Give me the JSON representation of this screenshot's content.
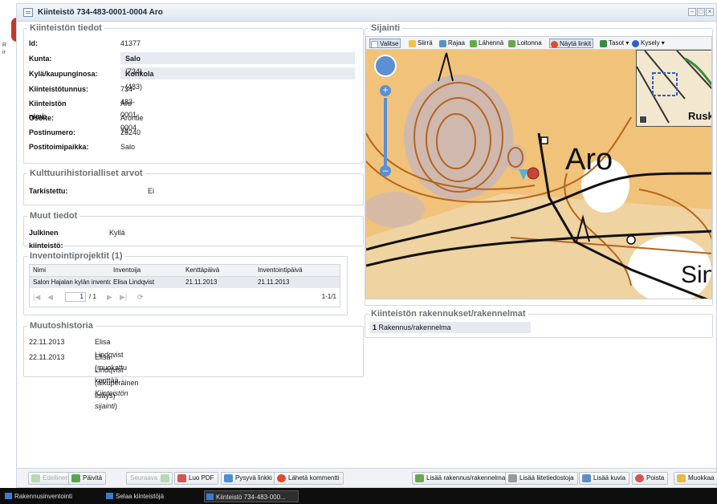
{
  "window": {
    "title": "Kiinteistö 734-483-0001-0004 Aro"
  },
  "background_app": {
    "initial": "R",
    "line2": "ir"
  },
  "kiinteisto": {
    "legend": "Kiinteistön tiedot",
    "fields": [
      {
        "label": "Id:",
        "value": "41377",
        "bold": "",
        "paren": ""
      },
      {
        "label": "Kunta:",
        "value": "",
        "bold": "Salo",
        "paren": "(734)"
      },
      {
        "label": "Kylä/kaupunginosa:",
        "value": "",
        "bold": "Konkola",
        "paren": "(483)"
      },
      {
        "label": "Kiinteistötunnus:",
        "value": "734-483-0001-0004",
        "bold": "",
        "paren": ""
      },
      {
        "label": "Kiinteistön nimi:",
        "value": "Aro",
        "bold": "",
        "paren": ""
      },
      {
        "label": "Osoite:",
        "value": "Arontie 73",
        "bold": "",
        "paren": ""
      },
      {
        "label": "Postinumero:",
        "value": "25240",
        "bold": "",
        "paren": ""
      },
      {
        "label": "Postitoimipaikka:",
        "value": "Salo",
        "bold": "",
        "paren": ""
      }
    ]
  },
  "kulttuuri": {
    "legend": "Kulttuurihistorialliset arvot",
    "label": "Tarkistettu:",
    "value": "Ei"
  },
  "muut": {
    "legend": "Muut tiedot",
    "label": "Julkinen kiinteistö:",
    "value": "Kyllä"
  },
  "inventointi": {
    "legend": "Inventointiprojektit (1)",
    "columns": [
      "Nimi",
      "Inventoija",
      "Kenttäpäivä",
      "Inventointipäivä"
    ],
    "row": [
      "Salon Hajalan kylän inventointi",
      "Elisa Lindqvist",
      "21.11.2013",
      "21.11.2013"
    ],
    "page": "1",
    "pages": "/ 1",
    "range": "1-1/1"
  },
  "muutos": {
    "legend": "Muutoshistoria",
    "entries": [
      {
        "date": "22.11.2013",
        "text": "Elisa Lindqvist (muokattu kenttää ",
        "em": "Kiinteistön sijainti",
        "tail": ")"
      },
      {
        "date": "22.11.2013",
        "text": "Elisa Lindqvist (alkuperäinen lisäys)",
        "em": "",
        "tail": ""
      }
    ]
  },
  "sijainti": {
    "legend": "Sijainti",
    "toolbar": [
      "Valitse",
      "Siirrä",
      "Rajaa",
      "Lähennä",
      "Loitonna",
      "Näytä linkit",
      "Tasot ▾",
      "Kysely ▾"
    ],
    "map_labels": {
      "aro": "Aro",
      "sin": "Sin",
      "ruska": "Ruska"
    },
    "colors": {
      "fill": "#f0c27a",
      "contour": "#b5651d",
      "road": "#111111",
      "marsh": "#c4b4c0",
      "marker": "#c8443a"
    }
  },
  "rakennukset": {
    "legend": "Kiinteistön rakennukset/rakennelmat",
    "count": "1",
    "item": "Rakennus/rakennelma"
  },
  "bottom_left": [
    "Edellinen",
    "Päivitä",
    "Seuraava",
    "Luo PDF",
    "Pysyvä linkki",
    "Lähetä kommentti"
  ],
  "bottom_right": [
    "Lisää rakennus/rakennelma",
    "Lisää liitetiedostoja",
    "Lisää kuvia",
    "Poista",
    "Muokkaa"
  ],
  "taskbar": [
    "Rakennusinventointi",
    "Selaa kiinteistöjä",
    "Kiinteistö 734-483-000..."
  ]
}
